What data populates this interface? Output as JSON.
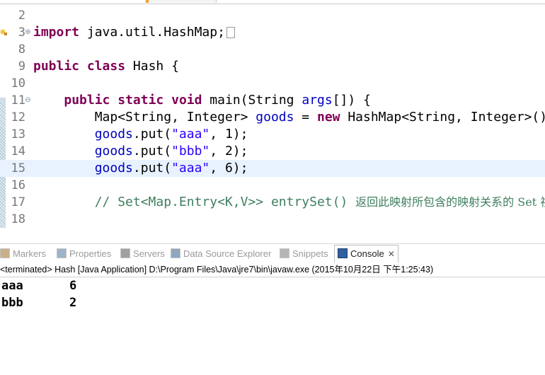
{
  "editor": {
    "lines": [
      {
        "num": "2"
      },
      {
        "num": "3",
        "tokens": [
          [
            "kw",
            "import"
          ],
          [
            "plain",
            " java.util.HashMap;"
          ]
        ]
      },
      {
        "num": "8"
      },
      {
        "num": "9",
        "tokens": [
          [
            "kw",
            "public"
          ],
          [
            "plain",
            " "
          ],
          [
            "kw",
            "class"
          ],
          [
            "plain",
            " Hash {"
          ]
        ]
      },
      {
        "num": "10"
      },
      {
        "num": "11",
        "tokens": [
          [
            "plain",
            "    "
          ],
          [
            "kw",
            "public"
          ],
          [
            "plain",
            " "
          ],
          [
            "kw",
            "static"
          ],
          [
            "plain",
            " "
          ],
          [
            "kw",
            "void"
          ],
          [
            "plain",
            " main(String "
          ],
          [
            "var",
            "args"
          ],
          [
            "plain",
            "[]) {"
          ]
        ]
      },
      {
        "num": "12",
        "tokens": [
          [
            "plain",
            "        Map<String, Integer> "
          ],
          [
            "var",
            "goods"
          ],
          [
            "plain",
            " = "
          ],
          [
            "kw",
            "new"
          ],
          [
            "plain",
            " HashMap<String, Integer>();"
          ]
        ]
      },
      {
        "num": "13",
        "tokens": [
          [
            "plain",
            "        "
          ],
          [
            "var",
            "goods"
          ],
          [
            "plain",
            ".put("
          ],
          [
            "str",
            "\"aaa\""
          ],
          [
            "plain",
            ", 1);"
          ]
        ]
      },
      {
        "num": "14",
        "tokens": [
          [
            "plain",
            "        "
          ],
          [
            "var",
            "goods"
          ],
          [
            "plain",
            ".put("
          ],
          [
            "str",
            "\"bbb\""
          ],
          [
            "plain",
            ", 2);"
          ]
        ]
      },
      {
        "num": "15",
        "tokens": [
          [
            "plain",
            "        "
          ],
          [
            "var",
            "goods"
          ],
          [
            "plain",
            ".put("
          ],
          [
            "str",
            "\"aaa\""
          ],
          [
            "plain",
            ", 6);"
          ]
        ]
      },
      {
        "num": "16"
      },
      {
        "num": "17",
        "tokens": [
          [
            "plain",
            "        "
          ],
          [
            "cmt",
            "// Set<Map.Entry<K,V>> entrySet() "
          ],
          [
            "cjk",
            "返回此映射所包含的映射关系的 Set 视图"
          ]
        ]
      },
      {
        "num": "18"
      }
    ]
  },
  "views": {
    "tabs": [
      {
        "label": "Markers",
        "icon": "markers-icon"
      },
      {
        "label": "Properties",
        "icon": "properties-icon"
      },
      {
        "label": "Servers",
        "icon": "servers-icon"
      },
      {
        "label": "Data Source Explorer",
        "icon": "data-source-icon"
      },
      {
        "label": "Snippets",
        "icon": "snippets-icon"
      },
      {
        "label": "Console",
        "icon": "console-icon",
        "active": true
      }
    ],
    "close_glyph": "✕"
  },
  "console": {
    "status": "<terminated> Hash [Java Application] D:\\Program Files\\Java\\jre7\\bin\\javaw.exe (2015年10月22日 下午1:25:43)",
    "output": [
      {
        "key": "aaa",
        "value": "6"
      },
      {
        "key": "bbb",
        "value": "2"
      }
    ]
  }
}
